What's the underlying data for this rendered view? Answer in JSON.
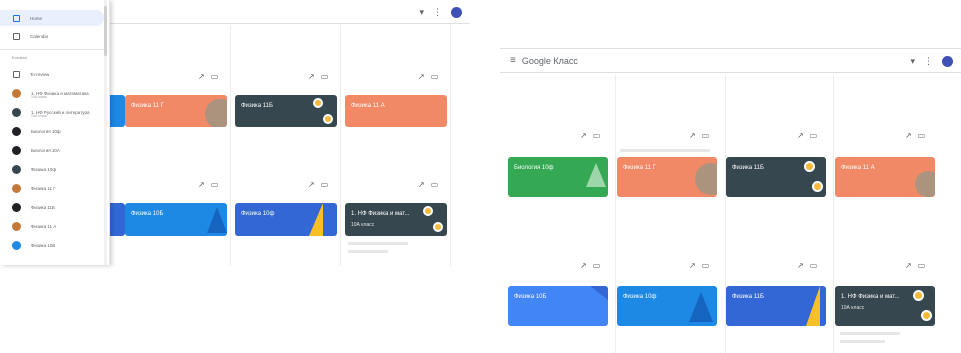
{
  "left_window": {
    "topbar": {
      "more_label": "▾",
      "apps_label": "⋮"
    },
    "sidebar": {
      "items": [
        {
          "label": "Home",
          "icon": "home-icon",
          "color": "#5f6368",
          "selected": true
        },
        {
          "label": "Calendar",
          "icon": "calendar-icon",
          "color": "#5f6368"
        }
      ],
      "section_label": "Enrolled",
      "section_items": [
        {
          "label": "To-review",
          "icon": "todo-icon",
          "color": "#5f6368"
        },
        {
          "label": "1. НФ Физика и математика",
          "sub": "10А класс",
          "color": "#c4793a"
        },
        {
          "label": "1. НФ Русский и литература",
          "sub": "10А класс",
          "color": "#37474f"
        },
        {
          "label": "Биология 10ф",
          "color": "#202124"
        },
        {
          "label": "Биология 10А",
          "color": "#202124"
        },
        {
          "label": "Физика 10ф",
          "color": "#37474f"
        },
        {
          "label": "Физика 11 Г",
          "color": "#c4793a"
        },
        {
          "label": "Физика 11Б",
          "color": "#202124"
        },
        {
          "label": "Физика 11 А",
          "color": "#c4793a"
        },
        {
          "label": "Физика 10Б",
          "color": "#1e88e5"
        }
      ]
    },
    "row1": [
      {
        "label": "Физика 11 Г",
        "color": "#f28966"
      },
      {
        "label": "Физика 11Б",
        "color": "#37474f"
      },
      {
        "label": "Физика 11 А",
        "color": "#f28966"
      }
    ],
    "row2": [
      {
        "label": "Физика 10Б",
        "color": "#1e88e5"
      },
      {
        "label": "Физика 10ф",
        "color": "#3367d6"
      },
      {
        "label": "1. НФ Физика и мат...",
        "sub": "10А класс",
        "color": "#37474f"
      }
    ],
    "controls": {
      "trend": "↗",
      "folder": "▭"
    }
  },
  "right_window": {
    "topbar": {
      "menu_label": "≡",
      "title": "Google Класс",
      "more_label": "▾",
      "apps_label": "⋮"
    },
    "row1": [
      {
        "label": "Биология 10ф",
        "color": "#34a853"
      },
      {
        "label": "Физика 11 Г",
        "color": "#f28966"
      },
      {
        "label": "Физика 11Б",
        "color": "#37474f"
      },
      {
        "label": "Физика 11 А",
        "color": "#f28966"
      }
    ],
    "row2": [
      {
        "label": "Физика 10Б",
        "color": "#4285f4"
      },
      {
        "label": "Физика 10ф",
        "color": "#1e88e5"
      },
      {
        "label": "Физика 11Б",
        "color": "#3367d6"
      },
      {
        "label": "1. НФ Физика и мат...",
        "sub": "10А класс",
        "color": "#37474f"
      }
    ],
    "controls": {
      "trend": "↗",
      "folder": "▭"
    }
  }
}
